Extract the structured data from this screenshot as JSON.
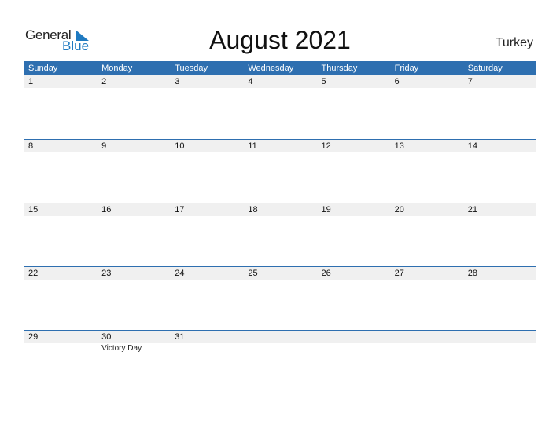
{
  "logo": {
    "text_general": "General",
    "text_blue": "Blue",
    "icon": "triangle-flag-icon",
    "brand_color": "#1f7ac1"
  },
  "title": "August 2021",
  "country": "Turkey",
  "header_color": "#2e6fb0",
  "weekdays": [
    "Sunday",
    "Monday",
    "Tuesday",
    "Wednesday",
    "Thursday",
    "Friday",
    "Saturday"
  ],
  "weeks": [
    {
      "days": [
        "1",
        "2",
        "3",
        "4",
        "5",
        "6",
        "7"
      ],
      "events": [
        "",
        "",
        "",
        "",
        "",
        "",
        ""
      ]
    },
    {
      "days": [
        "8",
        "9",
        "10",
        "11",
        "12",
        "13",
        "14"
      ],
      "events": [
        "",
        "",
        "",
        "",
        "",
        "",
        ""
      ]
    },
    {
      "days": [
        "15",
        "16",
        "17",
        "18",
        "19",
        "20",
        "21"
      ],
      "events": [
        "",
        "",
        "",
        "",
        "",
        "",
        ""
      ]
    },
    {
      "days": [
        "22",
        "23",
        "24",
        "25",
        "26",
        "27",
        "28"
      ],
      "events": [
        "",
        "",
        "",
        "",
        "",
        "",
        ""
      ]
    },
    {
      "days": [
        "29",
        "30",
        "31",
        "",
        "",
        "",
        ""
      ],
      "events": [
        "",
        "Victory Day",
        "",
        "",
        "",
        "",
        ""
      ]
    }
  ]
}
